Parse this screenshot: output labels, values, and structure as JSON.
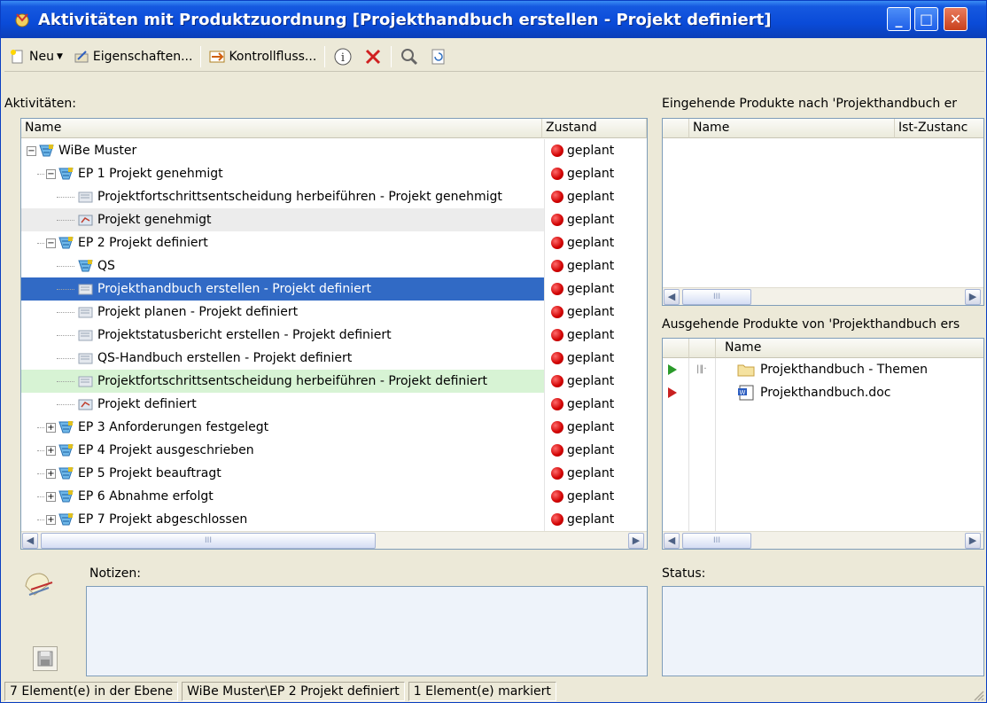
{
  "window": {
    "title": "Aktivitäten mit Produktzuordnung [Projekthandbuch erstellen - Projekt definiert]",
    "minimize": "_",
    "maximize": "□",
    "close": "✕"
  },
  "toolbar": {
    "new_label": "Neu",
    "properties_label": "Eigenschaften...",
    "controlflow_label": "Kontrollfluss..."
  },
  "activities": {
    "label": "Aktivitäten:",
    "col_name": "Name",
    "col_state": "Zustand",
    "rows": [
      {
        "name": "WiBe Muster",
        "state": "geplant"
      },
      {
        "name": "EP 1 Projekt genehmigt",
        "state": "geplant"
      },
      {
        "name": "Projektfortschrittsentscheidung herbeiführen - Projekt genehmigt",
        "state": "geplant"
      },
      {
        "name": "Projekt genehmigt",
        "state": "geplant"
      },
      {
        "name": "EP 2 Projekt definiert",
        "state": "geplant"
      },
      {
        "name": "QS",
        "state": "geplant"
      },
      {
        "name": "Projekthandbuch erstellen - Projekt definiert",
        "state": "geplant"
      },
      {
        "name": "Projekt planen - Projekt definiert",
        "state": "geplant"
      },
      {
        "name": "Projektstatusbericht erstellen - Projekt definiert",
        "state": "geplant"
      },
      {
        "name": "QS-Handbuch erstellen - Projekt definiert",
        "state": "geplant"
      },
      {
        "name": "Projektfortschrittsentscheidung herbeiführen - Projekt definiert",
        "state": "geplant"
      },
      {
        "name": "Projekt definiert",
        "state": "geplant"
      },
      {
        "name": "EP 3 Anforderungen festgelegt",
        "state": "geplant"
      },
      {
        "name": "EP 4 Projekt ausgeschrieben",
        "state": "geplant"
      },
      {
        "name": "EP 5 Projekt beauftragt",
        "state": "geplant"
      },
      {
        "name": "EP 6 Abnahme erfolgt",
        "state": "geplant"
      },
      {
        "name": "EP 7 Projekt abgeschlossen",
        "state": "geplant"
      }
    ]
  },
  "incoming": {
    "label": "Eingehende Produkte nach 'Projekthandbuch er",
    "col_name": "Name",
    "col_state": "Ist-Zustanc"
  },
  "outgoing": {
    "label": "Ausgehende Produkte von 'Projekthandbuch ers",
    "col_name": "Name",
    "rows": [
      {
        "name": "Projekthandbuch - Themen"
      },
      {
        "name": "Projekthandbuch.doc"
      }
    ]
  },
  "notes": {
    "label": "Notizen:"
  },
  "status": {
    "label": "Status:"
  },
  "scroll_thumb_grip": "III",
  "statusbar": {
    "count": "7 Element(e) in der Ebene",
    "path": "WiBe Muster\\EP 2 Projekt definiert",
    "marked": "1 Element(e) markiert"
  },
  "colors": {
    "selection": "#316ac5",
    "highlight_green": "#d7f3d4",
    "state_dot": "#d00000",
    "titlebar": "#0a4bd8"
  }
}
